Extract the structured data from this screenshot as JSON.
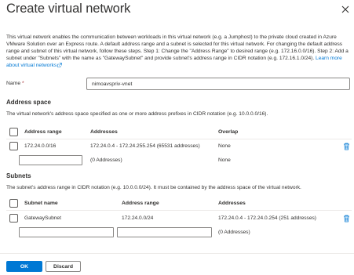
{
  "header": {
    "title": "Create virtual network",
    "close_icon": "close-icon"
  },
  "intro": {
    "text": "This virtual network enables the communication between workloads in this virtual network (e.g. a Jumphost) to the private cloud created in Azure VMware Solution over an Express route. A default address range and a subnet is selected for this virtual network. For changing the default address range and subnet of this virtual network, follow these steps. Step 1: Change the \"Address Range\" to desired range (e.g. 172.16.0.0/16). Step 2: Add a subnet under \"Subnets\" with the name as \"GatewaySubnet\" and provide subnet's address range in CIDR notation (e.g. 172.16.1.0/24).",
    "link_text": "Learn more about virtual networks",
    "link_icon": "external-link-icon"
  },
  "name_field": {
    "label": "Name",
    "required_mark": "*",
    "value": "nimoavspriv-vnet"
  },
  "address_space": {
    "heading": "Address space",
    "description": "The virtual network's address space specified as one or more address prefixes in CIDR notation (e.g. 10.0.0.0/16).",
    "columns": [
      "Address range",
      "Addresses",
      "Overlap"
    ],
    "rows": [
      {
        "range": "172.24.0.0/16",
        "addresses": "172.24.0.4 - 172.24.255.254 (65531 addresses)",
        "overlap": "None"
      }
    ],
    "new_row": {
      "range": "",
      "addresses": "(0 Addresses)",
      "overlap": "None"
    }
  },
  "subnets": {
    "heading": "Subnets",
    "description": "The subnet's address range in CIDR notation (e.g. 10.0.0.0/24). It must be contained by the address space of the virtual network.",
    "columns": [
      "Subnet name",
      "Address range",
      "Addresses"
    ],
    "rows": [
      {
        "name": "GatewaySubnet",
        "range": "172.24.0.0/24",
        "addresses": "172.24.0.4 - 172.24.0.254 (251 addresses)"
      }
    ],
    "new_row": {
      "name": "",
      "range": "",
      "addresses": "(0 Addresses)"
    }
  },
  "footer": {
    "ok_label": "OK",
    "discard_label": "Discard"
  },
  "colors": {
    "accent": "#0078d4",
    "text": "#323130",
    "required": "#a4262c",
    "border": "#8a8886"
  }
}
